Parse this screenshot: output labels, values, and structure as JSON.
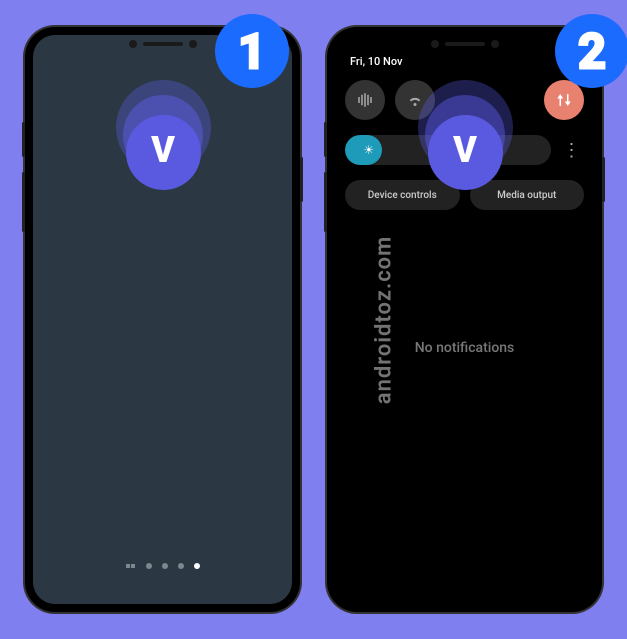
{
  "step1": {
    "number": "1"
  },
  "step2": {
    "number": "2",
    "date": "Fri, 10 Nov",
    "controls": {
      "device": "Device controls",
      "media": "Media output"
    },
    "empty_state": "No notifications"
  },
  "watermark": "androidtoz.com",
  "swipe_icon": "chevron-down"
}
